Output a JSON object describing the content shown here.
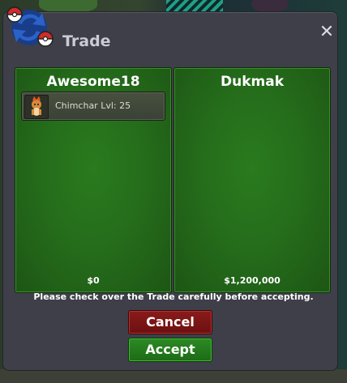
{
  "window": {
    "title": "Trade",
    "close_label": "✕"
  },
  "left_panel": {
    "player_name": "Awesome18",
    "items": [
      {
        "label": "Chimchar  Lvl: 25",
        "icon": "chimchar-icon"
      }
    ],
    "money": "$0"
  },
  "right_panel": {
    "player_name": "Dukmak",
    "items": [],
    "money": "$1,200,000"
  },
  "notice": "Please check over the Trade carefully before accepting.",
  "buttons": {
    "cancel": "Cancel",
    "accept": "Accept"
  },
  "colors": {
    "panel_green": "#256d1b",
    "cancel_red": "#7a1515",
    "accept_green": "#247a1d",
    "window_bg": "#3e3f48"
  }
}
